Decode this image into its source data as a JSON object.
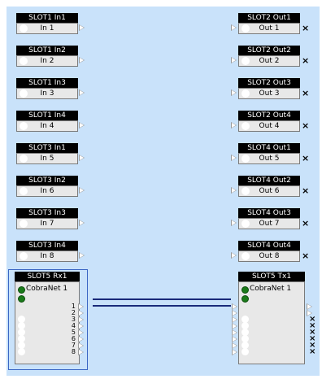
{
  "inputs": [
    {
      "title": "SLOT1 In1",
      "label": "In 1"
    },
    {
      "title": "SLOT1 In2",
      "label": "In 2"
    },
    {
      "title": "SLOT1 In3",
      "label": "In 3"
    },
    {
      "title": "SLOT1 In4",
      "label": "In 4"
    },
    {
      "title": "SLOT3 In1",
      "label": "In 5"
    },
    {
      "title": "SLOT3 In2",
      "label": "In 6"
    },
    {
      "title": "SLOT3 In3",
      "label": "In 7"
    },
    {
      "title": "SLOT3 In4",
      "label": "In 8"
    }
  ],
  "outputs": [
    {
      "title": "SLOT2 Out1",
      "label": "Out 1"
    },
    {
      "title": "SLOT2 Out2",
      "label": "Out 2"
    },
    {
      "title": "SLOT2 Out3",
      "label": "Out 3"
    },
    {
      "title": "SLOT2 Out4",
      "label": "Out 4"
    },
    {
      "title": "SLOT4 Out1",
      "label": "Out 5"
    },
    {
      "title": "SLOT4 Out2",
      "label": "Out 6"
    },
    {
      "title": "SLOT4 Out3",
      "label": "Out 7"
    },
    {
      "title": "SLOT4 Out4",
      "label": "Out 8"
    }
  ],
  "rx_block": {
    "title": "SLOT5 Rx1",
    "device": "CobraNet 1",
    "channels": [
      "1",
      "2",
      "3",
      "4",
      "5",
      "6",
      "7",
      "8"
    ]
  },
  "tx_block": {
    "title": "SLOT5 Tx1",
    "device": "CobraNet 1"
  },
  "disconnected_mark": "×",
  "colors": {
    "workspace": "#c9e2fa",
    "wire": "#1a2a7a",
    "title_bar": "#000000",
    "status_led": "#1a7a1a",
    "selection": "#3a66c4"
  }
}
